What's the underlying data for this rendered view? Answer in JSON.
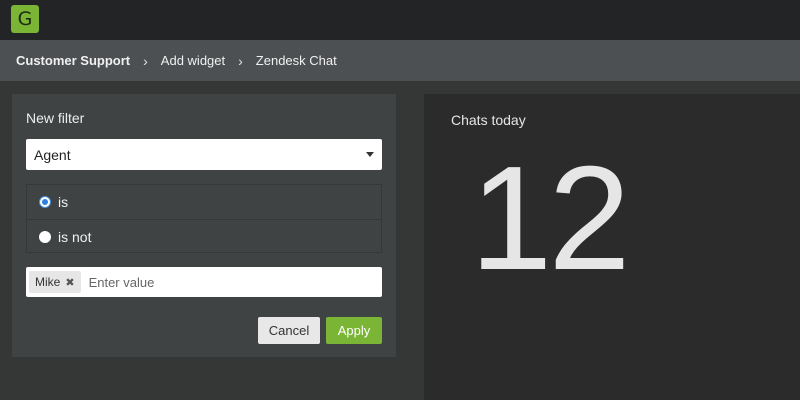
{
  "app": {
    "logo_letter": "G",
    "accent": "#7bb536"
  },
  "breadcrumb": {
    "items": [
      "Customer Support",
      "Add widget",
      "Zendesk Chat"
    ],
    "separator": "›"
  },
  "filter": {
    "title": "New filter",
    "field_select": {
      "value": "Agent"
    },
    "operators": [
      {
        "label": "is",
        "checked": true
      },
      {
        "label": "is not",
        "checked": false
      }
    ],
    "value_input": {
      "tags": [
        "Mike"
      ],
      "placeholder": "Enter value"
    },
    "cancel_label": "Cancel",
    "apply_label": "Apply"
  },
  "widget": {
    "title": "Chats today",
    "value": "12"
  }
}
